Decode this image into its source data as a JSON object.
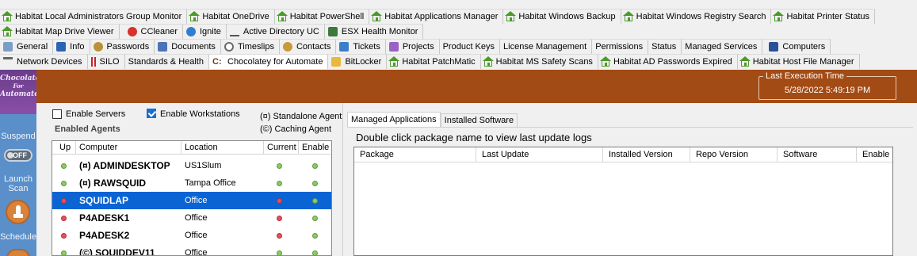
{
  "tabs": {
    "row1": [
      {
        "label": "Habitat Local Administrators Group Monitor",
        "icon": "house-icon"
      },
      {
        "label": "Habitat OneDrive",
        "icon": "house-icon"
      },
      {
        "label": "Habitat PowerShell",
        "icon": "house-icon"
      },
      {
        "label": "Habitat Applications Manager",
        "icon": "house-icon"
      },
      {
        "label": "Habitat Windows Backup",
        "icon": "house-icon"
      },
      {
        "label": "Habitat Windows Registry Search",
        "icon": "house-icon"
      },
      {
        "label": "Habitat Printer Status",
        "icon": "house-icon"
      }
    ],
    "row2": [
      {
        "label": "Habitat Map Drive Viewer",
        "icon": "house-icon"
      },
      {
        "label": "CCleaner",
        "icon": "ccleaner-icon"
      },
      {
        "label": "Ignite",
        "icon": "ignite-icon"
      },
      {
        "label": "Active Directory UC",
        "icon": "directory-tree-icon"
      },
      {
        "label": "ESX Health Monitor",
        "icon": "esx-icon"
      }
    ],
    "row3": [
      {
        "label": "General",
        "icon": "grid-icon"
      },
      {
        "label": "Info",
        "icon": "info-icon"
      },
      {
        "label": "Passwords",
        "icon": "key-icon"
      },
      {
        "label": "Documents",
        "icon": "documents-icon"
      },
      {
        "label": "Timeslips",
        "icon": "clock-icon"
      },
      {
        "label": "Contacts",
        "icon": "contacts-icon"
      },
      {
        "label": "Tickets",
        "icon": "tickets-icon"
      },
      {
        "label": "Projects",
        "icon": "projects-icon"
      },
      {
        "label": "Product Keys",
        "icon": ""
      },
      {
        "label": "License Management",
        "icon": ""
      },
      {
        "label": "Permissions",
        "icon": ""
      },
      {
        "label": "Status",
        "icon": ""
      },
      {
        "label": "Managed Services",
        "icon": ""
      },
      {
        "label": "Computers",
        "icon": "computers-icon"
      }
    ],
    "row4": [
      {
        "label": "Network Devices",
        "icon": "network-icon"
      },
      {
        "label": "SILO",
        "icon": "silo-icon"
      },
      {
        "label": "Standards & Health",
        "icon": ""
      },
      {
        "label": "Chocolatey for Automate",
        "icon": "chocolatey-icon",
        "active": true
      },
      {
        "label": "BitLocker",
        "icon": "lock-icon"
      },
      {
        "label": "Habitat PatchMatic",
        "icon": "house-icon"
      },
      {
        "label": "Habitat MS Safety Scans",
        "icon": "house-icon"
      },
      {
        "label": "Habitat AD Passwords Expired",
        "icon": "house-icon"
      },
      {
        "label": "Habitat Host File Manager",
        "icon": "house-icon"
      }
    ]
  },
  "rail": {
    "logo_line1": "Chocolatey",
    "logo_line2": "For",
    "logo_line3": "Automate",
    "suspend_label": "Suspend",
    "toggle_label": "OFF",
    "launch_label_1": "Launch",
    "launch_label_2": "Scan",
    "schedule_label": "Schedule"
  },
  "header": {
    "last_exec_label": "Last Execution Time",
    "last_exec_value": "5/28/2022 5:49:19 PM",
    "bar_color": "#a34b14"
  },
  "agents": {
    "enable_servers_label": "Enable Servers",
    "enable_servers_checked": false,
    "enable_workstations_label": "Enable Workstations",
    "enable_workstations_checked": true,
    "legend_standalone": "(¤) Standalone Agent",
    "legend_caching": "(©) Caching Agent",
    "group_label": "Enabled Agents",
    "columns": [
      "Up",
      "Computer",
      "Location",
      "Current",
      "Enable"
    ],
    "rows": [
      {
        "up": "green",
        "computer": "(¤) ADMINDESKTOP",
        "location": "US1Slum",
        "current": "green",
        "enable": "green",
        "selected": false
      },
      {
        "up": "green",
        "computer": "(¤) RAWSQUID",
        "location": "Tampa Office",
        "current": "green",
        "enable": "green",
        "selected": false
      },
      {
        "up": "red",
        "computer": "SQUIDLAP",
        "location": "Office",
        "current": "red",
        "enable": "green",
        "selected": true
      },
      {
        "up": "red",
        "computer": "P4ADESK1",
        "location": "Office",
        "current": "red",
        "enable": "green",
        "selected": false
      },
      {
        "up": "red",
        "computer": "P4ADESK2",
        "location": "Office",
        "current": "red",
        "enable": "green",
        "selected": false
      },
      {
        "up": "green",
        "computer": "(©) SQUIDDEV11",
        "location": "Office",
        "current": "green",
        "enable": "green",
        "selected": false
      }
    ]
  },
  "right": {
    "tabs": [
      {
        "label": "Managed Applications",
        "active": true
      },
      {
        "label": "Installed Software",
        "active": false
      }
    ],
    "hint": "Double click package name to view last update logs",
    "columns": [
      "Package",
      "Last Update",
      "Installed Version",
      "Repo Version",
      "Software",
      "Enable"
    ]
  },
  "colors": {
    "selection": "#0a64d4",
    "status_green": "#8dc86a",
    "status_red": "#e5505a",
    "rail_blue": "#5a8fc9"
  }
}
